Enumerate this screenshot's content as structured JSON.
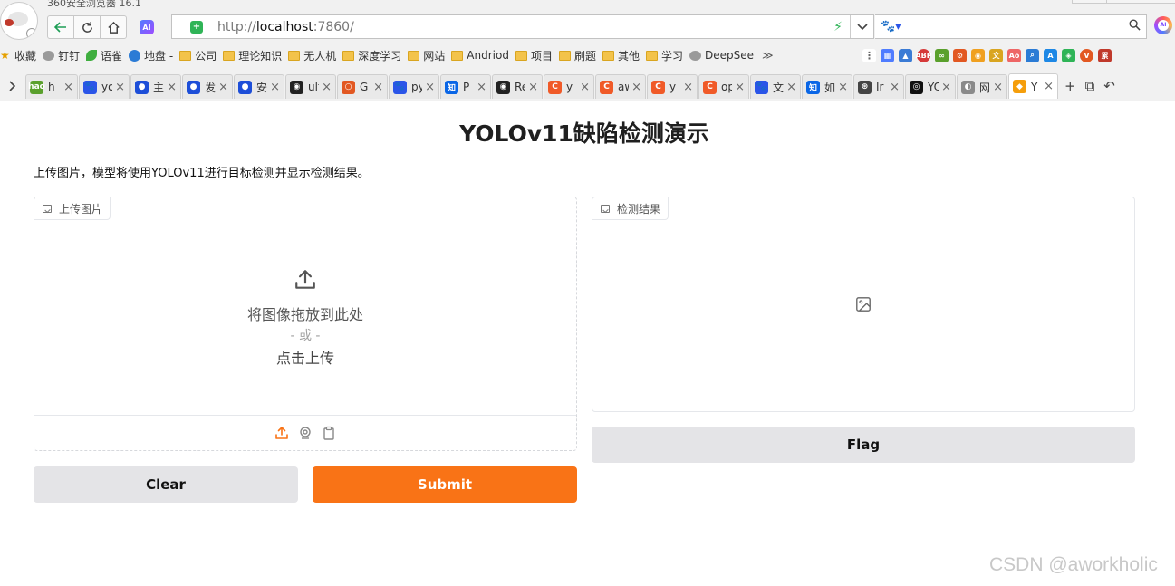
{
  "browser": {
    "window_title": "360安全浏览器 16.1",
    "url_prefix": "http://",
    "url_host": "localhost",
    "url_port": ":7860/",
    "bookmarks": [
      {
        "label": "收藏",
        "kind": "star"
      },
      {
        "label": "钉钉",
        "kind": "globe"
      },
      {
        "label": "语雀",
        "kind": "leaf"
      },
      {
        "label": "地盘 - ",
        "kind": "blue"
      },
      {
        "label": "公司",
        "kind": "folder"
      },
      {
        "label": "理论知识",
        "kind": "folder"
      },
      {
        "label": "无人机",
        "kind": "folder"
      },
      {
        "label": "深度学习",
        "kind": "folder"
      },
      {
        "label": "网站",
        "kind": "folder"
      },
      {
        "label": "Andriod",
        "kind": "folder"
      },
      {
        "label": "项目",
        "kind": "folder"
      },
      {
        "label": "刷题",
        "kind": "folder"
      },
      {
        "label": "其他",
        "kind": "folder"
      },
      {
        "label": "学习",
        "kind": "folder"
      },
      {
        "label": "DeepSee",
        "kind": "globe"
      }
    ],
    "bookmarks_more": "≫",
    "tabs": [
      {
        "label": "h",
        "color": "#5aa02c",
        "glyph": "hao"
      },
      {
        "label": "yol",
        "color": "#2b55e8",
        "glyph": "🐾"
      },
      {
        "label": "主",
        "color": "#1d4ed8",
        "glyph": "●"
      },
      {
        "label": "发",
        "color": "#1d4ed8",
        "glyph": "●"
      },
      {
        "label": "安",
        "color": "#1d4ed8",
        "glyph": "●"
      },
      {
        "label": "ult",
        "color": "#222222",
        "glyph": "◉"
      },
      {
        "label": "G",
        "color": "#e25822",
        "glyph": "○"
      },
      {
        "label": "pyt",
        "color": "#2b55e8",
        "glyph": "🐾"
      },
      {
        "label": "P",
        "color": "#0a66e6",
        "glyph": "知"
      },
      {
        "label": "Re",
        "color": "#222222",
        "glyph": "◉"
      },
      {
        "label": "y",
        "color": "#f05a28",
        "glyph": "C"
      },
      {
        "label": "aw",
        "color": "#f05a28",
        "glyph": "C"
      },
      {
        "label": "y",
        "color": "#f05a28",
        "glyph": "C"
      },
      {
        "label": "op",
        "color": "#f05a28",
        "glyph": "C"
      },
      {
        "label": "文",
        "color": "#2b55e8",
        "glyph": "🐾"
      },
      {
        "label": "如",
        "color": "#0a66e6",
        "glyph": "知"
      },
      {
        "label": "Ir",
        "color": "#444444",
        "glyph": "⊛"
      },
      {
        "label": "YO",
        "color": "#111111",
        "glyph": "◎"
      },
      {
        "label": "网",
        "color": "#8a8a8a",
        "glyph": "◐"
      },
      {
        "label": "Y",
        "color": "#f59e0b",
        "glyph": "◆",
        "active": true
      }
    ]
  },
  "app": {
    "title": "YOLOv11缺陷检测演示",
    "description": "上传图片，模型将使用YOLOv11进行目标检测并显示检测结果。",
    "input_label": "上传图片",
    "drop_text": "将图像拖放到此处",
    "or_text": "- 或 -",
    "click_text": "点击上传",
    "output_label": "检测结果",
    "clear_label": "Clear",
    "submit_label": "Submit",
    "flag_label": "Flag",
    "accent": "#f97316"
  },
  "watermark": "CSDN @aworkholic"
}
